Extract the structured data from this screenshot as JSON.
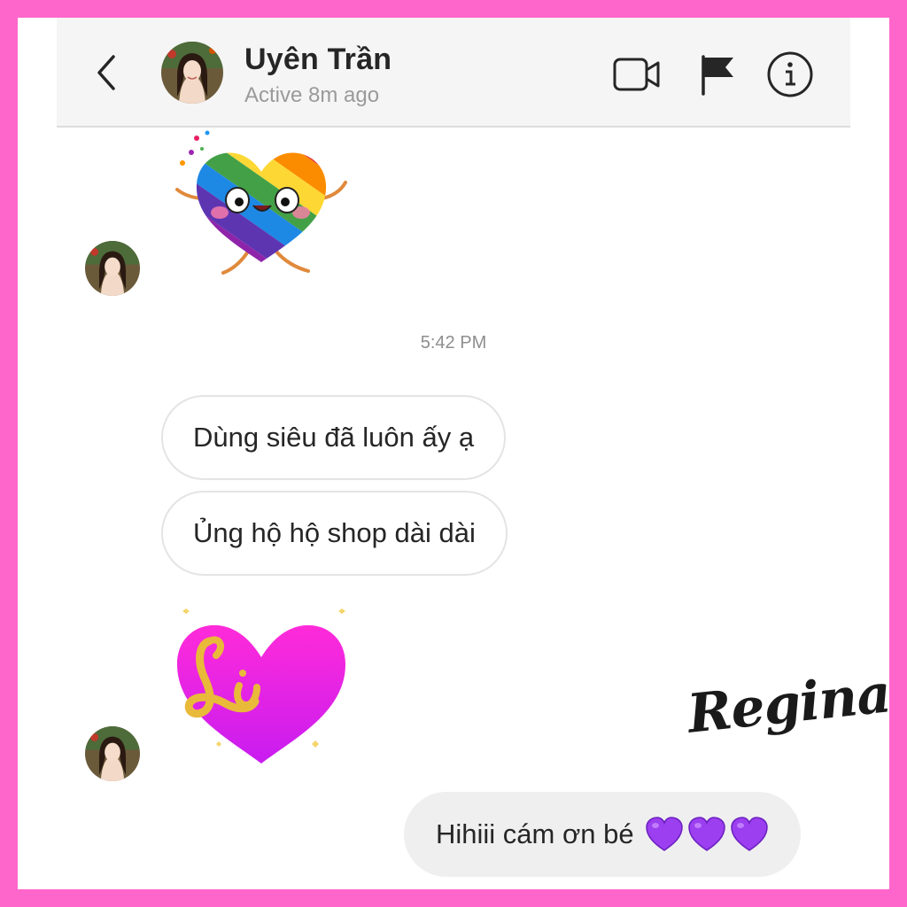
{
  "header": {
    "user_name": "Uyên Trần",
    "status": "Active 8m ago",
    "icons": [
      "chevron-left-icon",
      "video-call-icon",
      "flag-icon",
      "info-icon"
    ]
  },
  "messages": {
    "timestamp": "5:42 PM",
    "incoming": [
      {
        "text": "Dùng siêu đã luôn ấy ạ"
      },
      {
        "text": "Ủng hộ hộ shop dài dài"
      }
    ],
    "outgoing": [
      {
        "text": "Hihiii cám ơn bé",
        "emoji": [
          "purple-heart",
          "purple-heart",
          "purple-heart"
        ]
      }
    ],
    "stickers": [
      "rainbow-heart-sticker",
      "pink-heart-li-sticker"
    ]
  },
  "watermark": {
    "text": "Regina"
  },
  "colors": {
    "border": "#ff66cc",
    "header_bg": "#f5f5f5",
    "text": "#262626",
    "muted": "#9a9a9a",
    "outgoing_bg": "#efefef",
    "heart_purple": "#9b3ff0",
    "sticker_pink": "#ff22e6"
  }
}
